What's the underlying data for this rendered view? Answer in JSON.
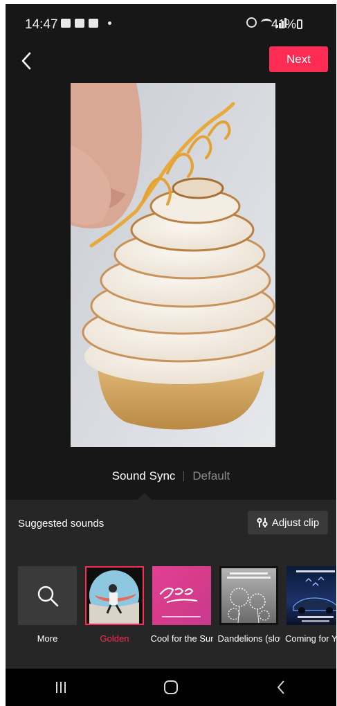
{
  "status_bar": {
    "time": "14:47",
    "battery": "41%"
  },
  "top_bar": {
    "next_label": "Next"
  },
  "mode_tabs": {
    "active": "Sound Sync",
    "inactive": "Default"
  },
  "sounds_panel": {
    "title": "Suggested sounds",
    "adjust_clip_label": "Adjust clip",
    "items": [
      {
        "label": "More",
        "selected": false,
        "icon": "search-icon"
      },
      {
        "label": "Golden",
        "selected": true
      },
      {
        "label": "Cool for the Summer",
        "selected": false
      },
      {
        "label": "Dandelions (slowed + reverb)",
        "selected": false
      },
      {
        "label": "Coming for You",
        "selected": false
      }
    ]
  },
  "colors": {
    "accent": "#fe2c55",
    "background": "#171717",
    "sheet": "#262626"
  }
}
